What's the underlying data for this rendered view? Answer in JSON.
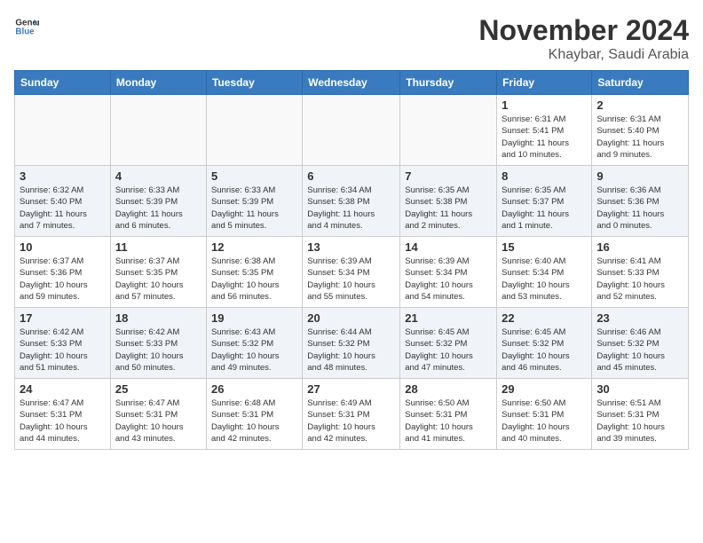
{
  "logo": {
    "text_general": "General",
    "text_blue": "Blue"
  },
  "header": {
    "month": "November 2024",
    "location": "Khaybar, Saudi Arabia"
  },
  "weekdays": [
    "Sunday",
    "Monday",
    "Tuesday",
    "Wednesday",
    "Thursday",
    "Friday",
    "Saturday"
  ],
  "weeks": [
    {
      "days": [
        {
          "day": "",
          "info": ""
        },
        {
          "day": "",
          "info": ""
        },
        {
          "day": "",
          "info": ""
        },
        {
          "day": "",
          "info": ""
        },
        {
          "day": "",
          "info": ""
        },
        {
          "day": "1",
          "info": "Sunrise: 6:31 AM\nSunset: 5:41 PM\nDaylight: 11 hours\nand 10 minutes."
        },
        {
          "day": "2",
          "info": "Sunrise: 6:31 AM\nSunset: 5:40 PM\nDaylight: 11 hours\nand 9 minutes."
        }
      ]
    },
    {
      "days": [
        {
          "day": "3",
          "info": "Sunrise: 6:32 AM\nSunset: 5:40 PM\nDaylight: 11 hours\nand 7 minutes."
        },
        {
          "day": "4",
          "info": "Sunrise: 6:33 AM\nSunset: 5:39 PM\nDaylight: 11 hours\nand 6 minutes."
        },
        {
          "day": "5",
          "info": "Sunrise: 6:33 AM\nSunset: 5:39 PM\nDaylight: 11 hours\nand 5 minutes."
        },
        {
          "day": "6",
          "info": "Sunrise: 6:34 AM\nSunset: 5:38 PM\nDaylight: 11 hours\nand 4 minutes."
        },
        {
          "day": "7",
          "info": "Sunrise: 6:35 AM\nSunset: 5:38 PM\nDaylight: 11 hours\nand 2 minutes."
        },
        {
          "day": "8",
          "info": "Sunrise: 6:35 AM\nSunset: 5:37 PM\nDaylight: 11 hours\nand 1 minute."
        },
        {
          "day": "9",
          "info": "Sunrise: 6:36 AM\nSunset: 5:36 PM\nDaylight: 11 hours\nand 0 minutes."
        }
      ]
    },
    {
      "days": [
        {
          "day": "10",
          "info": "Sunrise: 6:37 AM\nSunset: 5:36 PM\nDaylight: 10 hours\nand 59 minutes."
        },
        {
          "day": "11",
          "info": "Sunrise: 6:37 AM\nSunset: 5:35 PM\nDaylight: 10 hours\nand 57 minutes."
        },
        {
          "day": "12",
          "info": "Sunrise: 6:38 AM\nSunset: 5:35 PM\nDaylight: 10 hours\nand 56 minutes."
        },
        {
          "day": "13",
          "info": "Sunrise: 6:39 AM\nSunset: 5:34 PM\nDaylight: 10 hours\nand 55 minutes."
        },
        {
          "day": "14",
          "info": "Sunrise: 6:39 AM\nSunset: 5:34 PM\nDaylight: 10 hours\nand 54 minutes."
        },
        {
          "day": "15",
          "info": "Sunrise: 6:40 AM\nSunset: 5:34 PM\nDaylight: 10 hours\nand 53 minutes."
        },
        {
          "day": "16",
          "info": "Sunrise: 6:41 AM\nSunset: 5:33 PM\nDaylight: 10 hours\nand 52 minutes."
        }
      ]
    },
    {
      "days": [
        {
          "day": "17",
          "info": "Sunrise: 6:42 AM\nSunset: 5:33 PM\nDaylight: 10 hours\nand 51 minutes."
        },
        {
          "day": "18",
          "info": "Sunrise: 6:42 AM\nSunset: 5:33 PM\nDaylight: 10 hours\nand 50 minutes."
        },
        {
          "day": "19",
          "info": "Sunrise: 6:43 AM\nSunset: 5:32 PM\nDaylight: 10 hours\nand 49 minutes."
        },
        {
          "day": "20",
          "info": "Sunrise: 6:44 AM\nSunset: 5:32 PM\nDaylight: 10 hours\nand 48 minutes."
        },
        {
          "day": "21",
          "info": "Sunrise: 6:45 AM\nSunset: 5:32 PM\nDaylight: 10 hours\nand 47 minutes."
        },
        {
          "day": "22",
          "info": "Sunrise: 6:45 AM\nSunset: 5:32 PM\nDaylight: 10 hours\nand 46 minutes."
        },
        {
          "day": "23",
          "info": "Sunrise: 6:46 AM\nSunset: 5:32 PM\nDaylight: 10 hours\nand 45 minutes."
        }
      ]
    },
    {
      "days": [
        {
          "day": "24",
          "info": "Sunrise: 6:47 AM\nSunset: 5:31 PM\nDaylight: 10 hours\nand 44 minutes."
        },
        {
          "day": "25",
          "info": "Sunrise: 6:47 AM\nSunset: 5:31 PM\nDaylight: 10 hours\nand 43 minutes."
        },
        {
          "day": "26",
          "info": "Sunrise: 6:48 AM\nSunset: 5:31 PM\nDaylight: 10 hours\nand 42 minutes."
        },
        {
          "day": "27",
          "info": "Sunrise: 6:49 AM\nSunset: 5:31 PM\nDaylight: 10 hours\nand 42 minutes."
        },
        {
          "day": "28",
          "info": "Sunrise: 6:50 AM\nSunset: 5:31 PM\nDaylight: 10 hours\nand 41 minutes."
        },
        {
          "day": "29",
          "info": "Sunrise: 6:50 AM\nSunset: 5:31 PM\nDaylight: 10 hours\nand 40 minutes."
        },
        {
          "day": "30",
          "info": "Sunrise: 6:51 AM\nSunset: 5:31 PM\nDaylight: 10 hours\nand 39 minutes."
        }
      ]
    }
  ]
}
